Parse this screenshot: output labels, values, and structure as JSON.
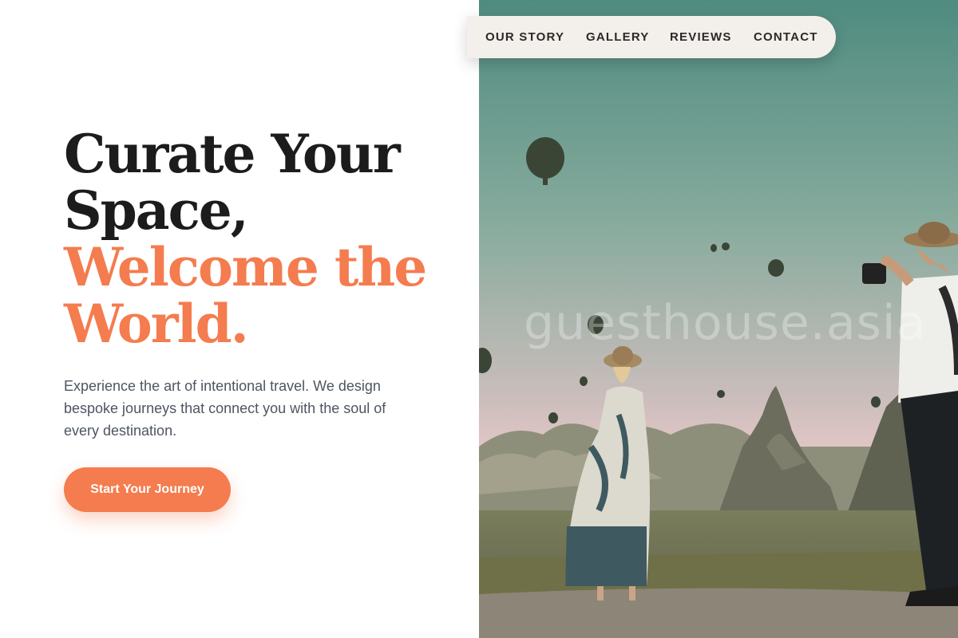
{
  "hero": {
    "headline_line1": "Curate Your",
    "headline_line2": "Space,",
    "headline_line3": "Welcome the",
    "headline_line4": "World.",
    "description": "Experience the art of intentional travel. We design bespoke journeys that connect you with the soul of every destination.",
    "cta_label": "Start Your Journey"
  },
  "nav": {
    "items": [
      {
        "label": "OUR STORY"
      },
      {
        "label": "GALLERY"
      },
      {
        "label": "REVIEWS"
      },
      {
        "label": "CONTACT"
      }
    ]
  },
  "photo": {
    "watermark": "guesthouse.asia",
    "subject": "travelers-hot-air-balloons-photo"
  },
  "colors": {
    "accent": "#f47c4e",
    "headline": "#1c1c1c",
    "body_text": "#4e5561",
    "nav_background": "#f3efea"
  }
}
